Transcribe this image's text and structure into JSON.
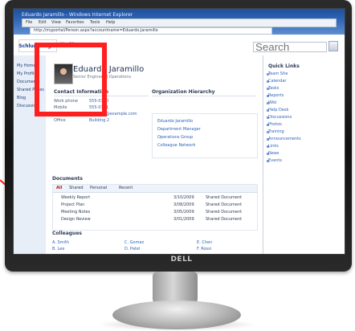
{
  "brand": {
    "label": "DELL"
  },
  "browser": {
    "title": "Eduardo Jaramillo - Windows Internet Explorer",
    "menu": [
      "File",
      "Edit",
      "View",
      "Favorites",
      "Tools",
      "Help"
    ],
    "address": "http://myportal/Person.aspx?accountname=Eduardo.Jaramillo"
  },
  "site": {
    "logo": "Schlumberger",
    "mysite": "My Site",
    "search_placeholder": "Search"
  },
  "nav": {
    "items": [
      "My Home",
      "My Profile",
      "Documents",
      "Shared Pages",
      "Blog",
      "Discussion"
    ]
  },
  "profile": {
    "name": "Eduardo Jaramillo",
    "subtitle": "Senior Engineer | Operations",
    "contact_section": "Contact Information",
    "contact_labels": [
      "Work phone",
      "Mobile",
      "E-mail",
      "Office"
    ],
    "contact_values": [
      "555-0100",
      "555-0101",
      "eduardo@example.com",
      "Building 2"
    ],
    "org_section": "Organization Hierarchy",
    "org_lines": [
      "Eduardo Jaramillo",
      "Department Manager",
      "Operations Group",
      "Colleague Network"
    ],
    "documents_section": "Documents",
    "tabs": [
      "All",
      "Shared",
      "Personal",
      "Recent"
    ],
    "rows": [
      {
        "name": "Weekly Report",
        "date": "3/10/2009",
        "type": "Shared Document"
      },
      {
        "name": "Project Plan",
        "date": "3/08/2009",
        "type": "Shared Document"
      },
      {
        "name": "Meeting Notes",
        "date": "3/05/2009",
        "type": "Shared Document"
      },
      {
        "name": "Design Review",
        "date": "3/01/2009",
        "type": "Shared Document"
      }
    ],
    "colleagues_section": "Colleagues",
    "colleagues": [
      "A. Smith",
      "B. Lee",
      "C. Gomez",
      "D. Patel",
      "E. Chen",
      "F. Rossi"
    ]
  },
  "right_panel": {
    "title": "Quick Links",
    "items": [
      "Team Site",
      "Calendar",
      "Tasks",
      "Reports",
      "Wiki",
      "Help Desk",
      "Discussions",
      "Photos",
      "Training",
      "Announcements",
      "Links",
      "News",
      "Events"
    ]
  },
  "colors": {
    "highlight": "#ff1f1f",
    "ie_blue": "#2e64b6",
    "link_blue": "#2f63b6"
  }
}
